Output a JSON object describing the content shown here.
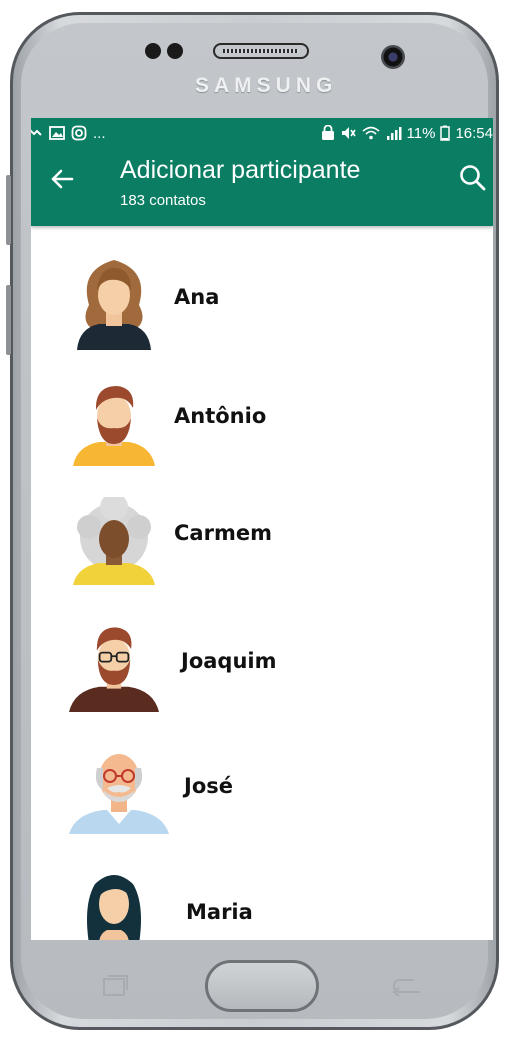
{
  "device": {
    "brand": "SAMSUNG"
  },
  "status_bar": {
    "left_icons": [
      "missed-call-icon",
      "image-icon",
      "instagram-icon"
    ],
    "left_more": "...",
    "battery": "11%",
    "time": "16:54"
  },
  "app_bar": {
    "title": "Adicionar participante",
    "subtitle": "183 contatos",
    "accent": "#0a7d63"
  },
  "contacts": [
    {
      "name": "Ana",
      "avatar": "woman-curly-hair-avatar"
    },
    {
      "name": "Antônio",
      "avatar": "bearded-man-avatar"
    },
    {
      "name": "Carmem",
      "avatar": "elderly-woman-gray-hair-avatar"
    },
    {
      "name": "Joaquim",
      "avatar": "man-glasses-beard-avatar"
    },
    {
      "name": "José",
      "avatar": "old-man-glasses-mustache-avatar"
    },
    {
      "name": "Maria",
      "avatar": "woman-dark-hair-avatar"
    }
  ]
}
